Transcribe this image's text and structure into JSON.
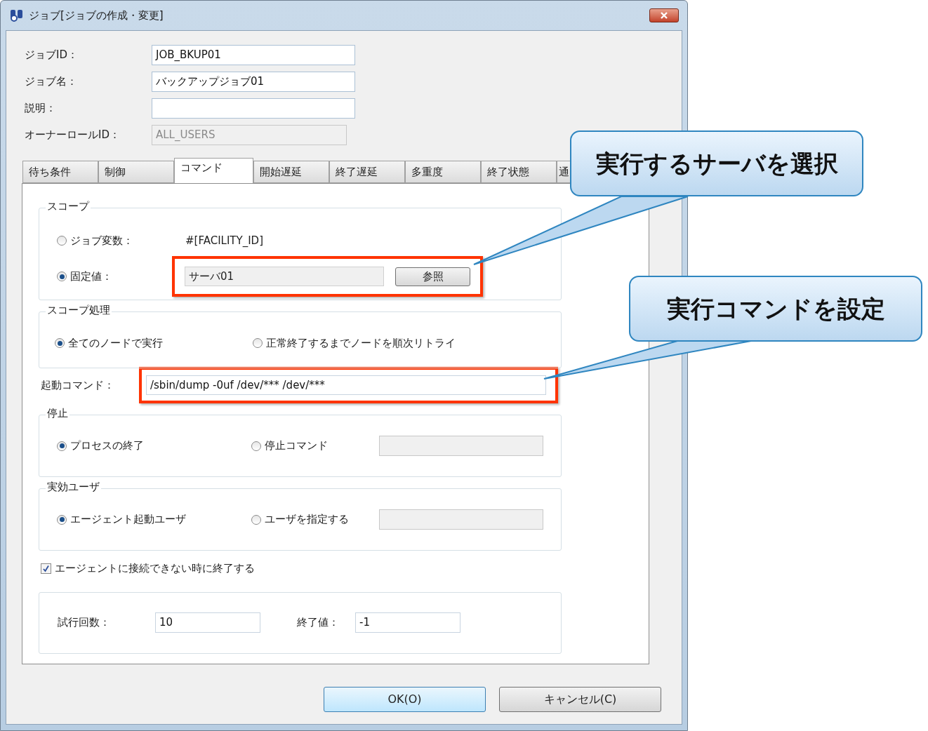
{
  "window": {
    "title": "ジョブ[ジョブの作成・変更]"
  },
  "fields": [
    {
      "label": "ジョブID：",
      "value": "JOB_BKUP01",
      "disabled": false
    },
    {
      "label": "ジョブ名：",
      "value": "バックアップジョブ01",
      "disabled": false
    },
    {
      "label": "説明：",
      "disabled": false
    },
    {
      "label": "オーナーロールID：",
      "value": "ALL_USERS",
      "disabled": true
    }
  ],
  "tabs": [
    {
      "label": "待ち条件",
      "selected": false
    },
    {
      "label": "制御",
      "selected": false
    },
    {
      "label": "コマンド",
      "selected": true
    },
    {
      "label": "開始遅延",
      "selected": false
    },
    {
      "label": "終了遅延",
      "selected": false
    },
    {
      "label": "多重度",
      "selected": false
    },
    {
      "label": "終了状態",
      "selected": false
    },
    {
      "label": "通",
      "selected": false
    }
  ],
  "scope": {
    "title": "スコープ",
    "options": [
      {
        "label": "ジョブ変数：",
        "selected": false,
        "value": "#[FACILITY_ID]"
      },
      {
        "label": "固定値：",
        "selected": true,
        "value": "サーバ01",
        "button": "参照"
      }
    ]
  },
  "scope_processing": {
    "title": "スコープ処理",
    "options": [
      {
        "label": "全てのノードで実行",
        "selected": true
      },
      {
        "label": "正常終了するまでノードを順次リトライ",
        "selected": false
      }
    ]
  },
  "start_command": {
    "label": "起動コマンド：",
    "value": "/sbin/dump -0uf /dev/*** /dev/***"
  },
  "stop": {
    "title": "停止",
    "options": [
      {
        "label": "プロセスの終了",
        "selected": true
      },
      {
        "label": "停止コマンド",
        "selected": false
      }
    ]
  },
  "effective_user": {
    "title": "実効ユーザ",
    "options": [
      {
        "label": "エージェント起動ユーザ",
        "selected": true
      },
      {
        "label": "ユーザを指定する",
        "selected": false
      }
    ]
  },
  "end_on_disconnect": {
    "label": "エージェントに接続できない時に終了する",
    "checked": true
  },
  "retry": [
    {
      "label": "試行回数：",
      "value": "10"
    },
    {
      "label": "終了値：",
      "value": "-1"
    }
  ],
  "buttons": [
    {
      "label": "OK(O)",
      "default": true
    },
    {
      "label": "キャンセル(C)",
      "default": false
    }
  ],
  "callouts": [
    {
      "text": "実行するサーバを選択"
    },
    {
      "text": "実行コマンドを設定"
    }
  ]
}
